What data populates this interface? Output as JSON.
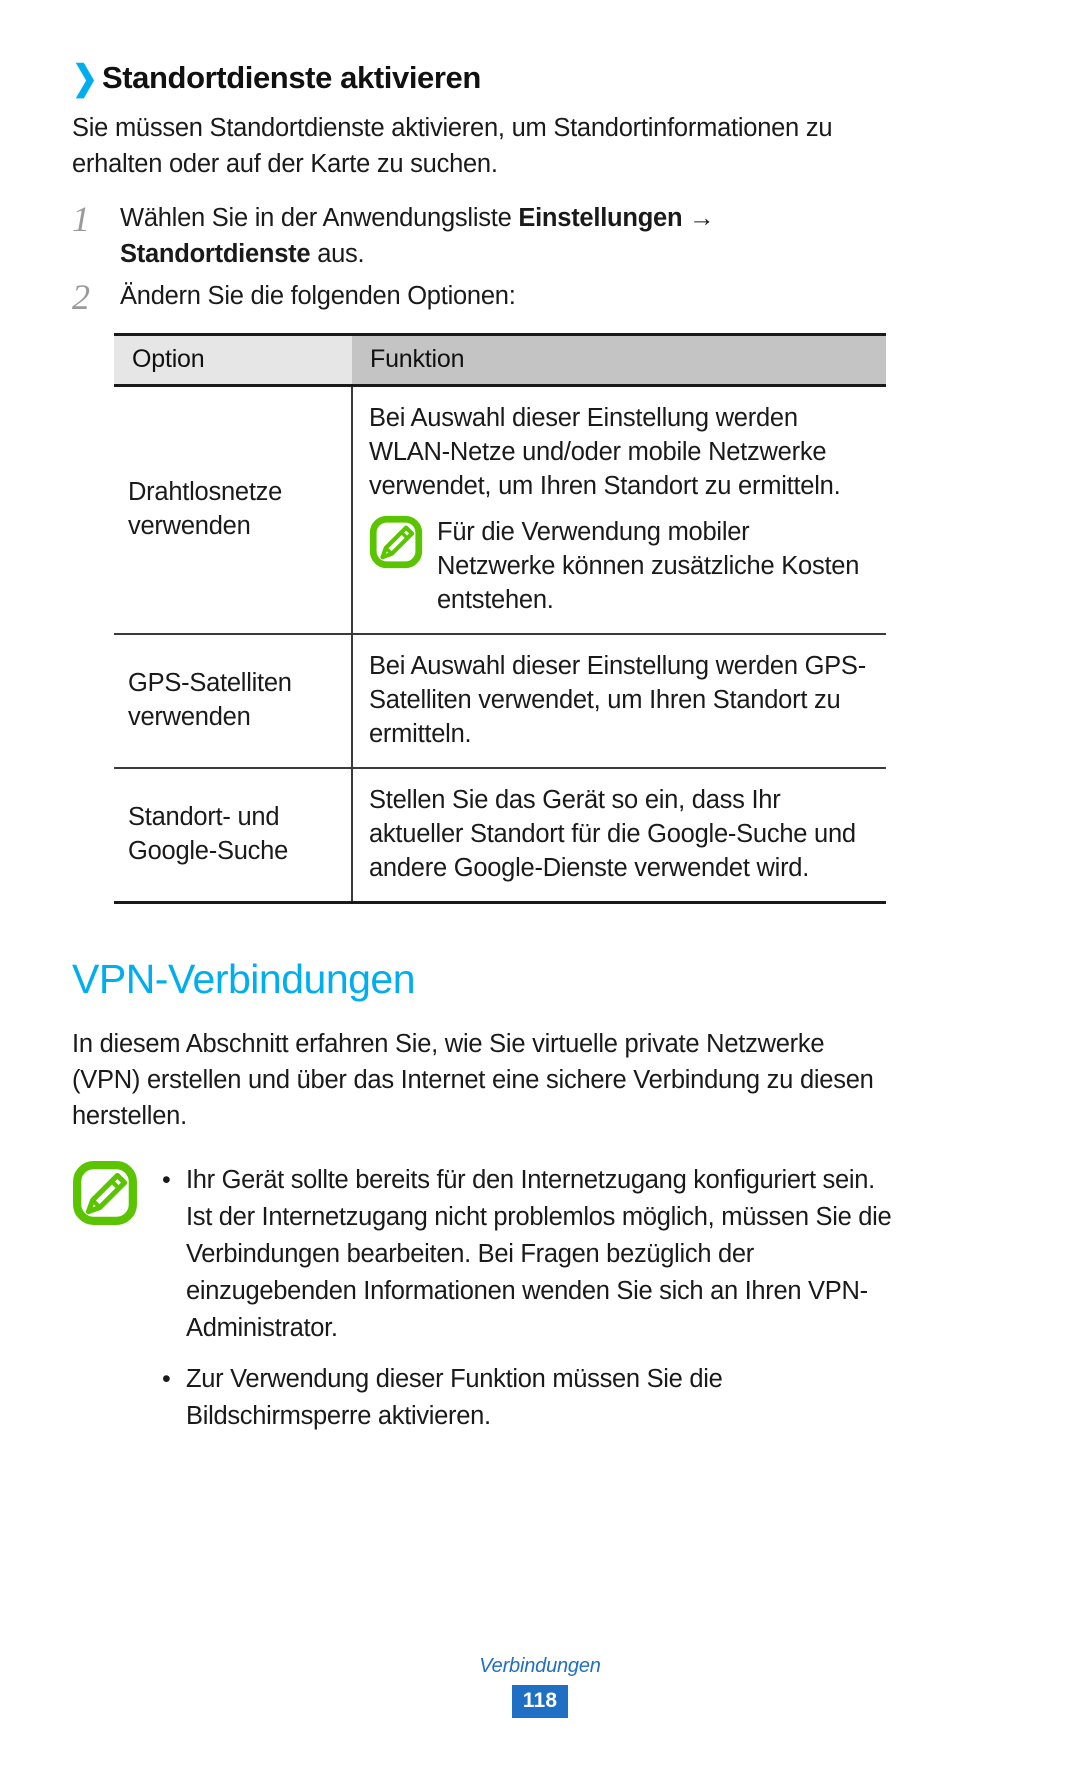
{
  "section": {
    "chevron": "❯",
    "title": "Standortdienste aktivieren",
    "intro": "Sie müssen Standortdienste aktivieren, um Standortinformationen zu erhalten oder auf der Karte zu suchen."
  },
  "steps": [
    {
      "num": "1",
      "text_1": "Wählen Sie in der Anwendungsliste ",
      "bold_1": "Einstellungen",
      "text_2": " → ",
      "bold_2": "Standortdienste",
      "text_3": " aus."
    },
    {
      "num": "2",
      "text_1": "Ändern Sie die folgenden Optionen:",
      "bold_1": "",
      "text_2": "",
      "bold_2": "",
      "text_3": ""
    }
  ],
  "table": {
    "headers": [
      "Option",
      "Funktion"
    ],
    "rows": [
      {
        "option": "Drahtlosnetze verwenden",
        "function": "Bei Auswahl dieser Einstellung werden WLAN-Netze und/oder mobile Netzwerke verwendet, um Ihren Standort zu ermitteln.",
        "note": "Für die Verwendung mobiler Netzwerke können zusätzliche Kosten entstehen.",
        "note_icon": "note-pen-icon"
      },
      {
        "option": "GPS-Satelliten verwenden",
        "function": "Bei Auswahl dieser Einstellung werden GPS-Satelliten verwendet, um Ihren Standort zu ermitteln.",
        "note": "",
        "note_icon": ""
      },
      {
        "option": "Standort- und Google-Suche",
        "function": "Stellen Sie das Gerät so ein, dass Ihr aktueller Standort für die Google-Suche und andere Google-Dienste verwendet wird.",
        "note": "",
        "note_icon": ""
      }
    ]
  },
  "vpn": {
    "heading": "VPN-Verbindungen",
    "intro": "In diesem Abschnitt erfahren Sie, wie Sie virtuelle private Netzwerke (VPN) erstellen und über das Internet eine sichere Verbindung zu diesen herstellen.",
    "note_icon": "note-pen-icon",
    "bullets": [
      "Ihr Gerät sollte bereits für den Internetzugang konfiguriert sein. Ist der Internetzugang nicht problemlos möglich, müssen Sie die Verbindungen bearbeiten. Bei Fragen bezüglich der einzugebenden Informationen wenden Sie sich an Ihren VPN-Administrator.",
      "Zur Verwendung dieser Funktion müssen Sie die Bildschirmsperre aktivieren."
    ]
  },
  "footer": {
    "category": "Verbindungen",
    "page_number": "118"
  },
  "colors": {
    "accent_blue": "#00AEEF",
    "note_green": "#5BC400",
    "footer_blue": "#1F6FC4",
    "header_light": "#E6E6E6",
    "header_dark": "#C4C4C4"
  }
}
